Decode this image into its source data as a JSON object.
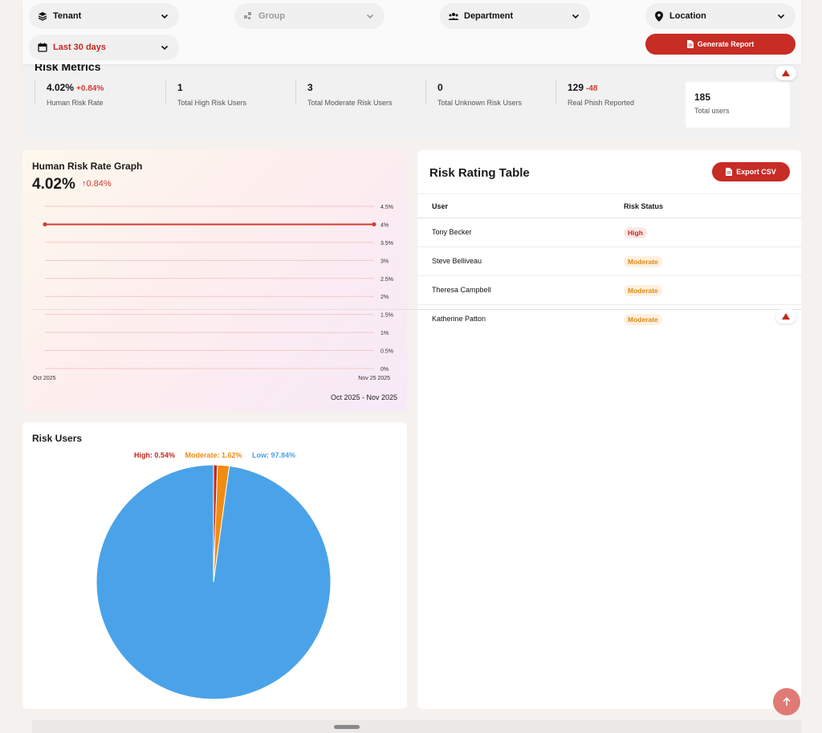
{
  "filters": {
    "tenant": "Tenant",
    "group": "Group",
    "department": "Department",
    "location": "Location",
    "date_range": "Last 30 days",
    "generate_report": "Generate Report"
  },
  "metrics": {
    "title": "Risk Metrics",
    "items": [
      {
        "value": "4.02%",
        "delta": "+0.84%",
        "label": "Human Risk Rate"
      },
      {
        "value": "1",
        "delta": "",
        "label": "Total High Risk Users"
      },
      {
        "value": "3",
        "delta": "",
        "label": "Total Moderate Risk Users"
      },
      {
        "value": "0",
        "delta": "",
        "label": "Total Unknown Risk Users"
      },
      {
        "value": "129",
        "delta": "-48",
        "label": "Real Phish Reported"
      }
    ],
    "total": {
      "value": "185",
      "label": "Total users"
    }
  },
  "graph": {
    "title": "Human Risk Rate Graph",
    "value": "4.02%",
    "delta": "0.84%",
    "range_label": "Oct 2025 - Nov 2025"
  },
  "chart_data": [
    {
      "type": "line",
      "title": "Human Risk Rate Graph",
      "x": [
        "Oct 2025",
        "Nov 25 2025"
      ],
      "series": [
        {
          "values": [
            4.0,
            4.0
          ]
        }
      ],
      "yticks": [
        "4.5%",
        "4%",
        "3.5%",
        "3%",
        "2.5%",
        "2%",
        "1.5%",
        "1%",
        "0.5%",
        "0%"
      ],
      "ylim": [
        0,
        4.5
      ],
      "grid": true,
      "color": "#d33a30"
    },
    {
      "type": "pie",
      "title": "Risk Users",
      "slices": [
        {
          "label": "High: 0.54%",
          "value": 0.54,
          "color": "#c5281c"
        },
        {
          "label": "Moderate: 1.62%",
          "value": 1.62,
          "color": "#f08c12"
        },
        {
          "label": "Low: 97.84%",
          "value": 97.84,
          "color": "#4aa3e8"
        }
      ],
      "legend": "top"
    }
  ],
  "table": {
    "title": "Risk Rating Table",
    "export_label": "Export CSV",
    "columns": [
      "User",
      "Risk Status"
    ],
    "rows": [
      {
        "user": "Tony Becker",
        "status": "High",
        "kind": "high"
      },
      {
        "user": "Steve Belliveau",
        "status": "Moderate",
        "kind": "moderate"
      },
      {
        "user": "Theresa Campbell",
        "status": "Moderate",
        "kind": "moderate"
      },
      {
        "user": "Katherine Patton",
        "status": "Moderate",
        "kind": "moderate"
      }
    ]
  },
  "colors": {
    "accent": "#c72c25",
    "high": "#c5281c",
    "moderate": "#f08c12",
    "low": "#4aa3e8"
  }
}
